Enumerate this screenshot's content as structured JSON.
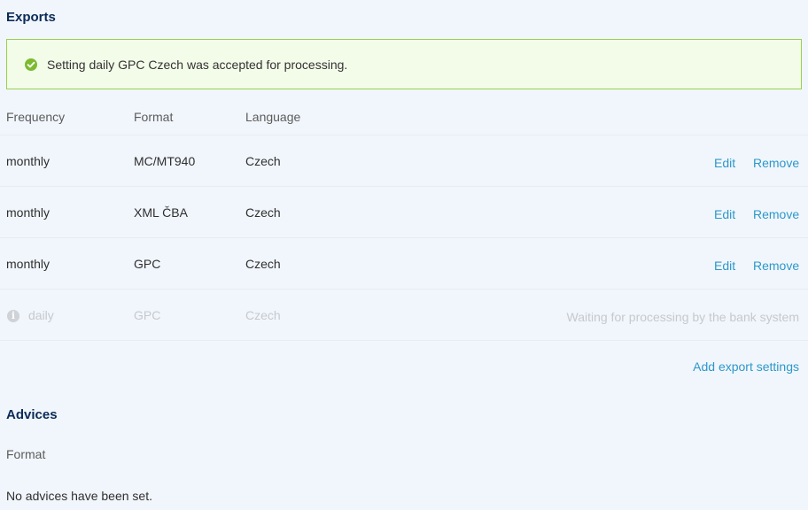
{
  "exports": {
    "title": "Exports",
    "alert": "Setting daily GPC Czech was accepted for processing.",
    "headers": {
      "frequency": "Frequency",
      "format": "Format",
      "language": "Language"
    },
    "rows": [
      {
        "frequency": "monthly",
        "format": "MC/MT940",
        "language": "Czech",
        "edit": "Edit",
        "remove": "Remove"
      },
      {
        "frequency": "monthly",
        "format": "XML ČBA",
        "language": "Czech",
        "edit": "Edit",
        "remove": "Remove"
      },
      {
        "frequency": "monthly",
        "format": "GPC",
        "language": "Czech",
        "edit": "Edit",
        "remove": "Remove"
      }
    ],
    "pending": {
      "frequency": "daily",
      "format": "GPC",
      "language": "Czech",
      "status": "Waiting for processing by the bank system"
    },
    "add_label": "Add export settings"
  },
  "advices": {
    "title": "Advices",
    "header_format": "Format",
    "empty": "No advices have been set."
  },
  "colors": {
    "background": "#f1f6fc",
    "heading": "#0b2b57",
    "link": "#2c98c9",
    "success_border": "#9bd04f",
    "success_icon": "#7cba2f"
  },
  "icons": {
    "alert": "check-circle-icon",
    "pending": "info-circle-icon"
  }
}
